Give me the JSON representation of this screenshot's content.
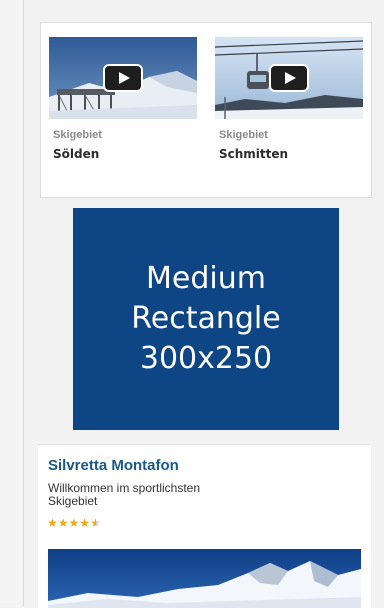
{
  "videos": [
    {
      "category": "Skigebiet",
      "title": "Sölden",
      "play_icon": "play-icon"
    },
    {
      "category": "Skigebiet",
      "title": "Schmitten",
      "play_icon": "play-icon"
    }
  ],
  "ad": {
    "lines": [
      "Medium",
      "Rectangle",
      "300x250"
    ],
    "background": "#0d4585"
  },
  "resort": {
    "name": "Silvretta Montafon",
    "description": "Willkommen im sportlichsten Skigebiet",
    "rating": 4.5,
    "rating_max": 5,
    "name_color": "#1a5887",
    "star_color": "#f0a814"
  }
}
